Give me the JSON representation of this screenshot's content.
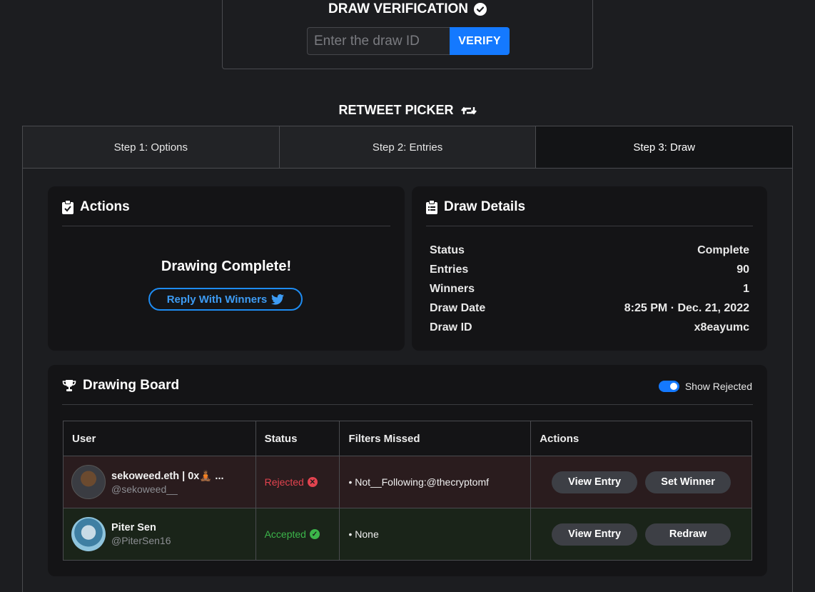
{
  "verification": {
    "title": "DRAW VERIFICATION",
    "placeholder": "Enter the draw ID",
    "button_label": "VERIFY"
  },
  "picker": {
    "title": "RETWEET PICKER",
    "tabs": [
      {
        "label": "Step 1: Options"
      },
      {
        "label": "Step 2: Entries"
      },
      {
        "label": "Step 3: Draw"
      }
    ]
  },
  "actions": {
    "title": "Actions",
    "message": "Drawing Complete!",
    "reply_label": "Reply With Winners"
  },
  "details": {
    "title": "Draw Details",
    "rows": [
      {
        "label": "Status",
        "value": "Complete"
      },
      {
        "label": "Entries",
        "value": "90"
      },
      {
        "label": "Winners",
        "value": "1"
      },
      {
        "label": "Draw Date",
        "value": "8:25 PM · Dec. 21, 2022"
      },
      {
        "label": "Draw ID",
        "value": "x8eayumc"
      }
    ]
  },
  "board": {
    "title": "Drawing Board",
    "toggle_label": "Show Rejected",
    "toggle_on": true,
    "columns": [
      "User",
      "Status",
      "Filters Missed",
      "Actions"
    ],
    "rows": [
      {
        "name": "sekoweed.eth | 0x🧘🏾 ...",
        "handle": "@sekoweed__",
        "status": "Rejected",
        "filters": "• Not__Following:@thecryptomf",
        "primary_action": "View Entry",
        "secondary_action": "Set Winner"
      },
      {
        "name": "Piter Sen",
        "handle": "@PiterSen16",
        "status": "Accepted",
        "filters": "• None",
        "primary_action": "View Entry",
        "secondary_action": "Redraw"
      }
    ]
  },
  "colors": {
    "accent": "#1479ff",
    "rejected": "#e2434f",
    "accepted": "#3cb54a",
    "background": "#1c1d20"
  }
}
